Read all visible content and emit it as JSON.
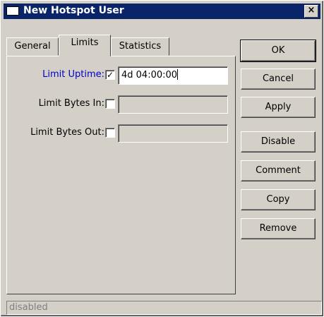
{
  "window": {
    "title": "New Hotspot User",
    "close_glyph": "×"
  },
  "tabs": [
    {
      "label": "General"
    },
    {
      "label": "Limits",
      "active": true
    },
    {
      "label": "Statistics"
    }
  ],
  "limits": {
    "uptime": {
      "label": "Limit Uptime:",
      "checked": true,
      "value": "4d 04:00:00"
    },
    "bytes_in": {
      "label": "Limit Bytes In:",
      "checked": false,
      "value": ""
    },
    "bytes_out": {
      "label": "Limit Bytes Out:",
      "checked": false,
      "value": ""
    }
  },
  "buttons": {
    "ok": "OK",
    "cancel": "Cancel",
    "apply": "Apply",
    "disable": "Disable",
    "comment": "Comment",
    "copy": "Copy",
    "remove": "Remove"
  },
  "status": "disabled",
  "colors": {
    "title_bar": "#0a246a",
    "highlight_label": "#0000cc",
    "face": "#d4d0c8"
  }
}
